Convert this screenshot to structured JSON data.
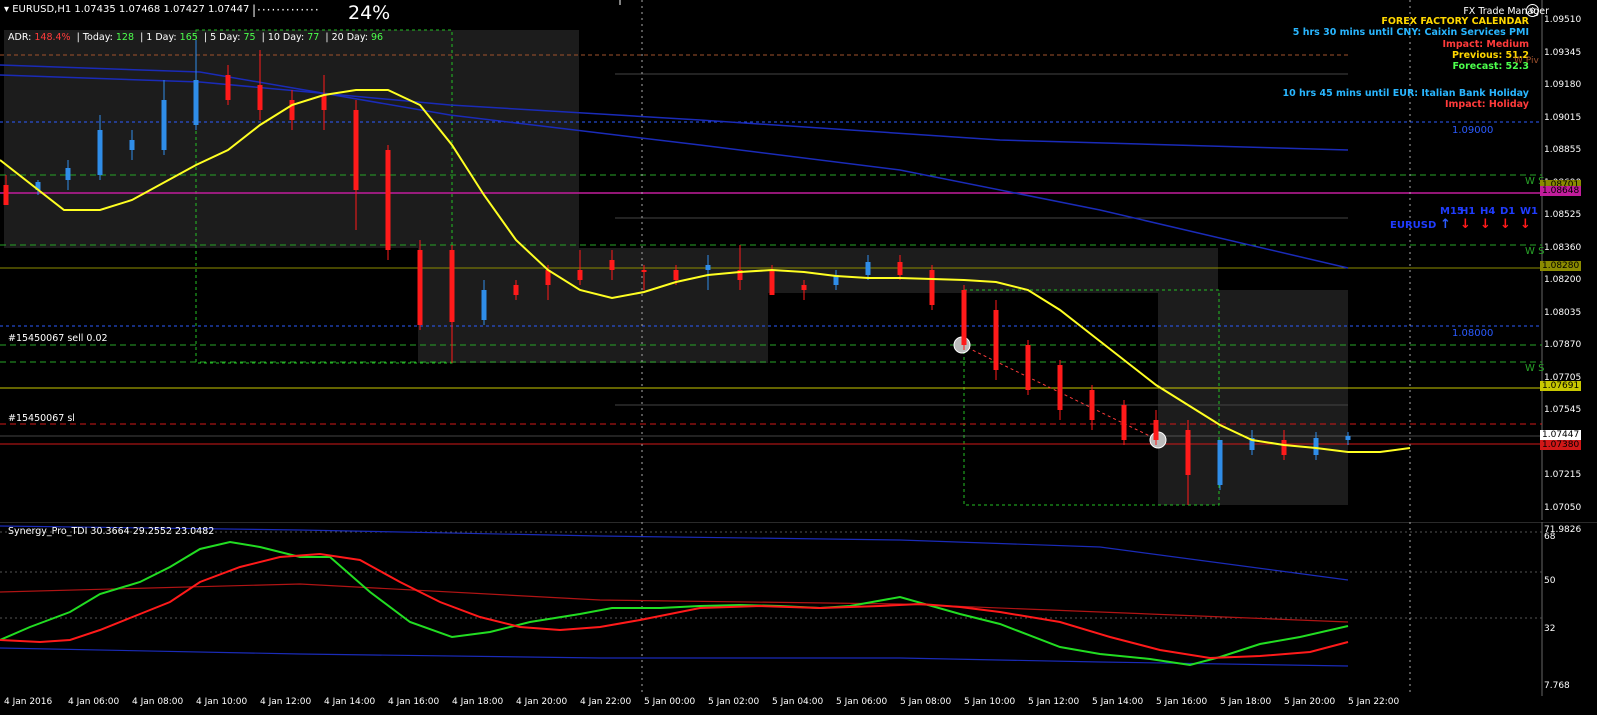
{
  "header": {
    "symbol_info": "EURUSD,H1  1.07435 1.07468 1.07427 1.07447",
    "progress_percent": "24%",
    "progress_dots": "|·············"
  },
  "adr": {
    "label": "ADR:",
    "value": "148.4%",
    "today_label": "| Today:",
    "today": "128",
    "day1_label": "| 1 Day:",
    "day1": "165",
    "day5_label": "| 5 Day:",
    "day5": "75",
    "day10_label": "| 10 Day:",
    "day10": "77",
    "day20_label": "| 20 Day:",
    "day20": "96"
  },
  "orders": {
    "sell": "#15450067 sell 0.02",
    "sl": "#15450067 sl"
  },
  "fx_manager": {
    "title": "FX Trade Manager",
    "calendar": "FOREX FACTORY CALENDAR",
    "event1": "5 hrs 30 mins until CNY: Caixin Services PMI",
    "event1_impact": "Impact: Medium",
    "event1_previous": "Previous: 51.2",
    "event1_forecast": "Forecast: 52.3",
    "event2": "10 hrs 45 mins until EUR: Italian Bank Holiday",
    "event2_impact": "Impact: Holiday"
  },
  "timeframes": {
    "symbol": "EURUSD",
    "labels": [
      "M15",
      "H1",
      "H4",
      "D1",
      "W1"
    ],
    "directions": [
      "up",
      "down",
      "down",
      "down",
      "down"
    ]
  },
  "levels": {
    "l1": "1.09000",
    "l2": "1.08000",
    "ws": "W S",
    "piv": "W Piv"
  },
  "price_axis": {
    "labels": [
      "1.09510",
      "1.09345",
      "1.09180",
      "1.09015",
      "1.08855",
      "1.08690",
      "1.08525",
      "1.08360",
      "1.08200",
      "1.08035",
      "1.07870",
      "1.07705",
      "1.07545",
      "1.07380",
      "1.07215",
      "1.07050"
    ],
    "boxes": [
      {
        "text": "1.08701",
        "color": "#8b8b00"
      },
      {
        "text": "1.08648",
        "color": "#c21d9c"
      },
      {
        "text": "1.08280",
        "color": "#8b8b00"
      },
      {
        "text": "1.07691",
        "color": "#c8c800"
      },
      {
        "text": "1.07447",
        "color": "#ffffff"
      },
      {
        "text": "1.07380",
        "color": "#d01818"
      }
    ]
  },
  "tdi": {
    "title": "Synergy_Pro_TDI 30.3664 29.2552 23.0482",
    "axis": [
      "71.9826",
      "68",
      "50",
      "32",
      "7.768"
    ]
  },
  "time_axis": [
    "4 Jan 2016",
    "4 Jan 06:00",
    "4 Jan 08:00",
    "4 Jan 10:00",
    "4 Jan 12:00",
    "4 Jan 14:00",
    "4 Jan 16:00",
    "4 Jan 18:00",
    "4 Jan 20:00",
    "4 Jan 22:00",
    "5 Jan 00:00",
    "5 Jan 02:00",
    "5 Jan 04:00",
    "5 Jan 06:00",
    "5 Jan 08:00",
    "5 Jan 10:00",
    "5 Jan 12:00",
    "5 Jan 14:00",
    "5 Jan 16:00",
    "5 Jan 18:00",
    "5 Jan 20:00",
    "5 Jan 22:00"
  ],
  "colors": {
    "bull": "#2f8de8",
    "bear": "#ff1a1a",
    "ma": "#ffff22",
    "tdi_green": "#22dd22",
    "tdi_red": "#ff1a1a"
  }
}
